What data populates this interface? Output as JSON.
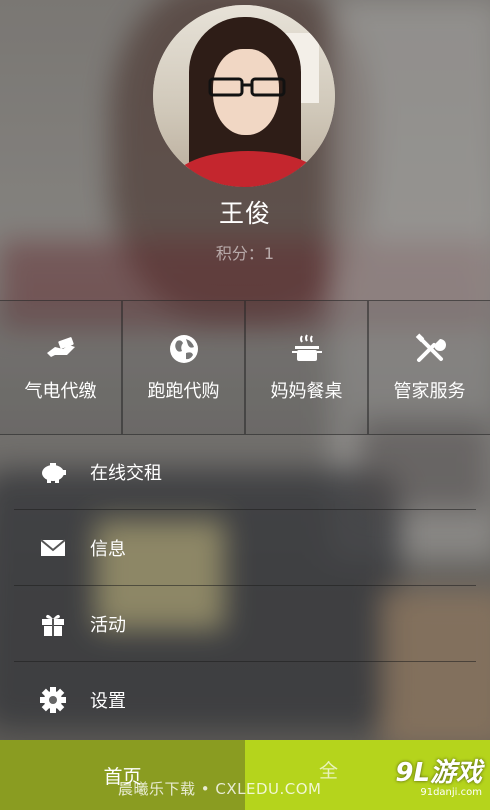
{
  "profile": {
    "name": "王俊",
    "points_label": "积分：",
    "points_value": "1"
  },
  "services": [
    {
      "label": "气电代缴",
      "icon": "hand-payment-icon"
    },
    {
      "label": "跑跑代购",
      "icon": "globe-icon"
    },
    {
      "label": "妈妈餐桌",
      "icon": "cooking-pot-icon"
    },
    {
      "label": "管家服务",
      "icon": "tools-icon"
    }
  ],
  "menu": [
    {
      "label": "在线交租",
      "icon": "piggy-bank-icon"
    },
    {
      "label": "信息",
      "icon": "envelope-icon"
    },
    {
      "label": "活动",
      "icon": "gift-icon"
    },
    {
      "label": "设置",
      "icon": "gear-icon"
    }
  ],
  "tabbar": {
    "home_label": "首页",
    "second_label_partial": "全"
  },
  "overlay": {
    "watermark": "晨曦乐下载 • CXLEDU.COM",
    "brand_logo": "9L游戏",
    "brand_site": "91danji.com"
  },
  "colors": {
    "tab_home_bg": "#8a9c21",
    "tab_second_bg": "#b5d41c"
  }
}
